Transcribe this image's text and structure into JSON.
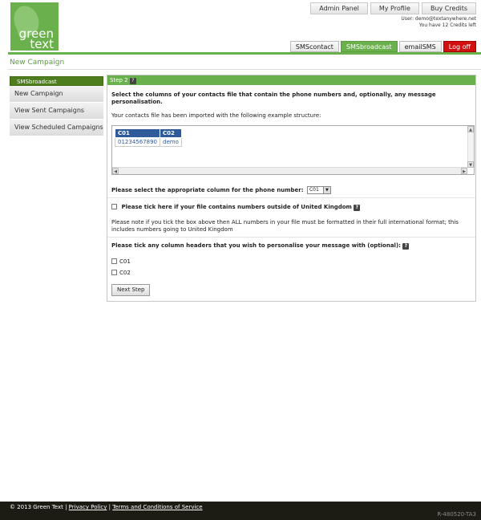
{
  "logo": {
    "line1": "green",
    "line2": "text"
  },
  "topnav": {
    "admin": "Admin Panel",
    "profile": "My Profile",
    "credits": "Buy Credits"
  },
  "user": {
    "line1": "User: demo@textanywhere.net",
    "line2": "You have 12 Credits left"
  },
  "tabs": [
    {
      "label": "SMScontact"
    },
    {
      "label": "SMSbroadcast"
    },
    {
      "label": "emailSMS"
    },
    {
      "label": "Log off"
    }
  ],
  "page": {
    "title": "New Campaign"
  },
  "sidebar": {
    "header": "SMSbroadcast",
    "items": [
      {
        "label": "New Campaign"
      },
      {
        "label": "View Sent Campaigns"
      },
      {
        "label": "View Scheduled Campaigns"
      }
    ]
  },
  "step": {
    "title": "Step 2",
    "instructions": "Select the columns of your contacts file that contain the phone numbers and, optionally, any message personalisation.",
    "imported": "Your contacts file has been imported with the following example structure:",
    "preview": {
      "headers": [
        "C01",
        "C02"
      ],
      "row": [
        "01234567890",
        "demo"
      ]
    },
    "phone_question": "Please select the appropriate column for the phone number:",
    "phone_selected": "C01",
    "intl_label": "Please tick here if your file contains numbers outside of United Kingdom",
    "intl_note": "Please note if you tick the box above then ALL numbers in your file must be formatted in their full international format; this includes numbers going to United Kingdom",
    "personal_question": "Please tick any column headers that you wish to personalise your message with (optional):",
    "options": [
      "C01",
      "C02"
    ],
    "next_label": "Next Step"
  },
  "footer": {
    "copyright": "© 2013 Green Text |",
    "privacy": "Privacy Policy",
    "sep": "|",
    "terms": "Terms and Conditions of Service",
    "code": "R-480520-TA3"
  },
  "colors": {
    "brand_green": "#6ab04c",
    "sidebar_header": "#4e7d1e",
    "logoff_red": "#d11010",
    "table_header": "#2f5b9b"
  }
}
